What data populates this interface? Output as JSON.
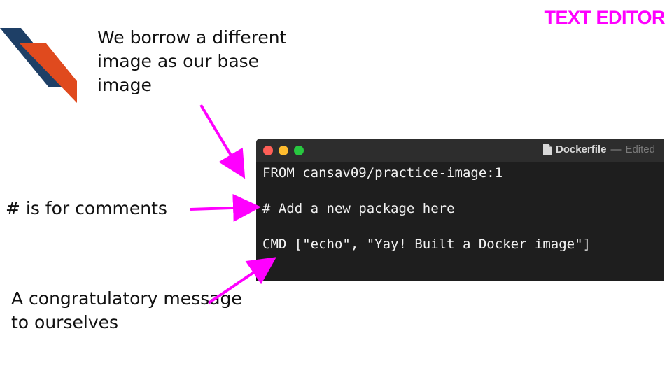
{
  "slide": {
    "section_title": "TEXT EDITOR",
    "accent_color": "#ff00ff"
  },
  "logo": {
    "colors": {
      "primary": "#1e3f66",
      "secondary": "#e04a1e"
    }
  },
  "annotations": {
    "base_image": "We borrow a different image as our base image",
    "comments": "# is for comments",
    "message": "A congratulatory message to ourselves"
  },
  "editor": {
    "filename": "Dockerfile",
    "separator": "—",
    "status": "Edited",
    "icon": "document-icon",
    "traffic_lights": {
      "close": "#ff5f57",
      "minimize": "#febc2e",
      "zoom": "#28c840"
    },
    "lines": [
      "FROM cansav09/practice-image:1",
      "# Add a new package here",
      "CMD [\"echo\", \"Yay! Built a Docker image\"]"
    ]
  }
}
